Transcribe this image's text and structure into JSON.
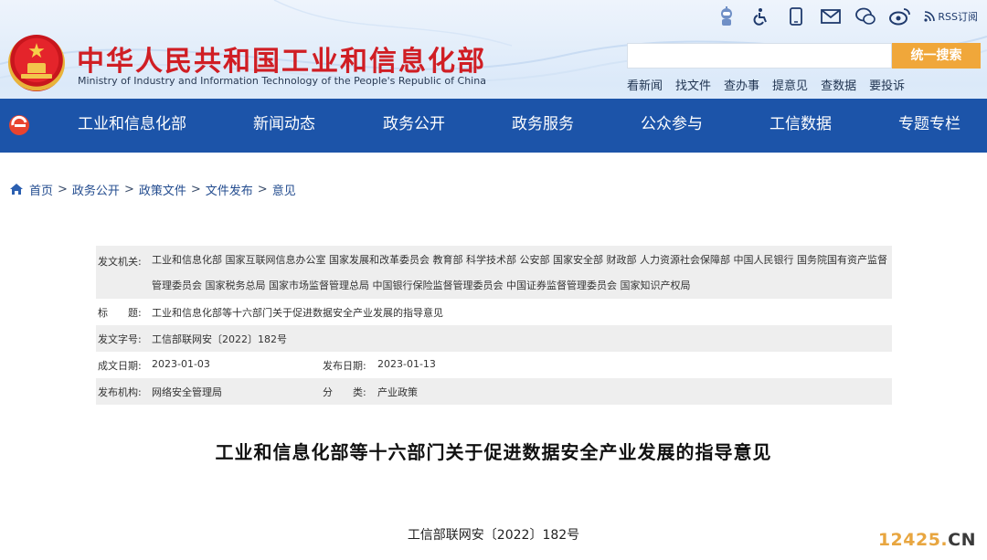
{
  "header": {
    "title": "中华人民共和国工业和信息化部",
    "subtitle": "Ministry of Industry and Information Technology of the People's Republic of China",
    "rss_label": "RSS订阅",
    "search_placeholder": "",
    "search_button": "统一搜索",
    "quick_links": [
      "看新闻",
      "找文件",
      "查办事",
      "提意见",
      "查数据",
      "要投诉"
    ],
    "top_icons": [
      "robot-icon",
      "accessibility-icon",
      "mobile-icon",
      "mail-icon",
      "wechat-icon",
      "weibo-icon",
      "rss-icon"
    ]
  },
  "nav": {
    "items": [
      "工业和信息化部",
      "新闻动态",
      "政务公开",
      "政务服务",
      "公众参与",
      "工信数据",
      "专题专栏"
    ]
  },
  "breadcrumb": [
    "首页",
    "政务公开",
    "政策文件",
    "文件发布",
    "意见"
  ],
  "meta": {
    "issuer_label": "发文机关:",
    "issuer_value": "工业和信息化部 国家互联网信息办公室 国家发展和改革委员会 教育部 科学技术部 公安部 国家安全部 财政部 人力资源社会保障部 中国人民银行 国务院国有资产监督管理委员会 国家税务总局 国家市场监督管理总局 中国银行保险监督管理委员会 中国证券监督管理委员会 国家知识产权局",
    "title_label": "标　　题:",
    "title_value": "工业和信息化部等十六部门关于促进数据安全产业发展的指导意见",
    "docno_label": "发文字号:",
    "docno_value": "工信部联网安〔2022〕182号",
    "created_label": "成文日期:",
    "created_value": "2023-01-03",
    "published_label": "发布日期:",
    "published_value": "2023-01-13",
    "org_label": "发布机构:",
    "org_value": "网络安全管理局",
    "category_label": "分　　类:",
    "category_value": "产业政策"
  },
  "document": {
    "title": "工业和信息化部等十六部门关于促进数据安全产业发展的指导意见",
    "number": "工信部联网安〔2022〕182号"
  },
  "watermark": {
    "digits": "12425.",
    "suffix": "CN"
  },
  "colors": {
    "brand_red": "#d01e24",
    "nav_blue": "#1c54a9",
    "search_orange": "#f0a73a",
    "link_blue": "#234c8f"
  }
}
